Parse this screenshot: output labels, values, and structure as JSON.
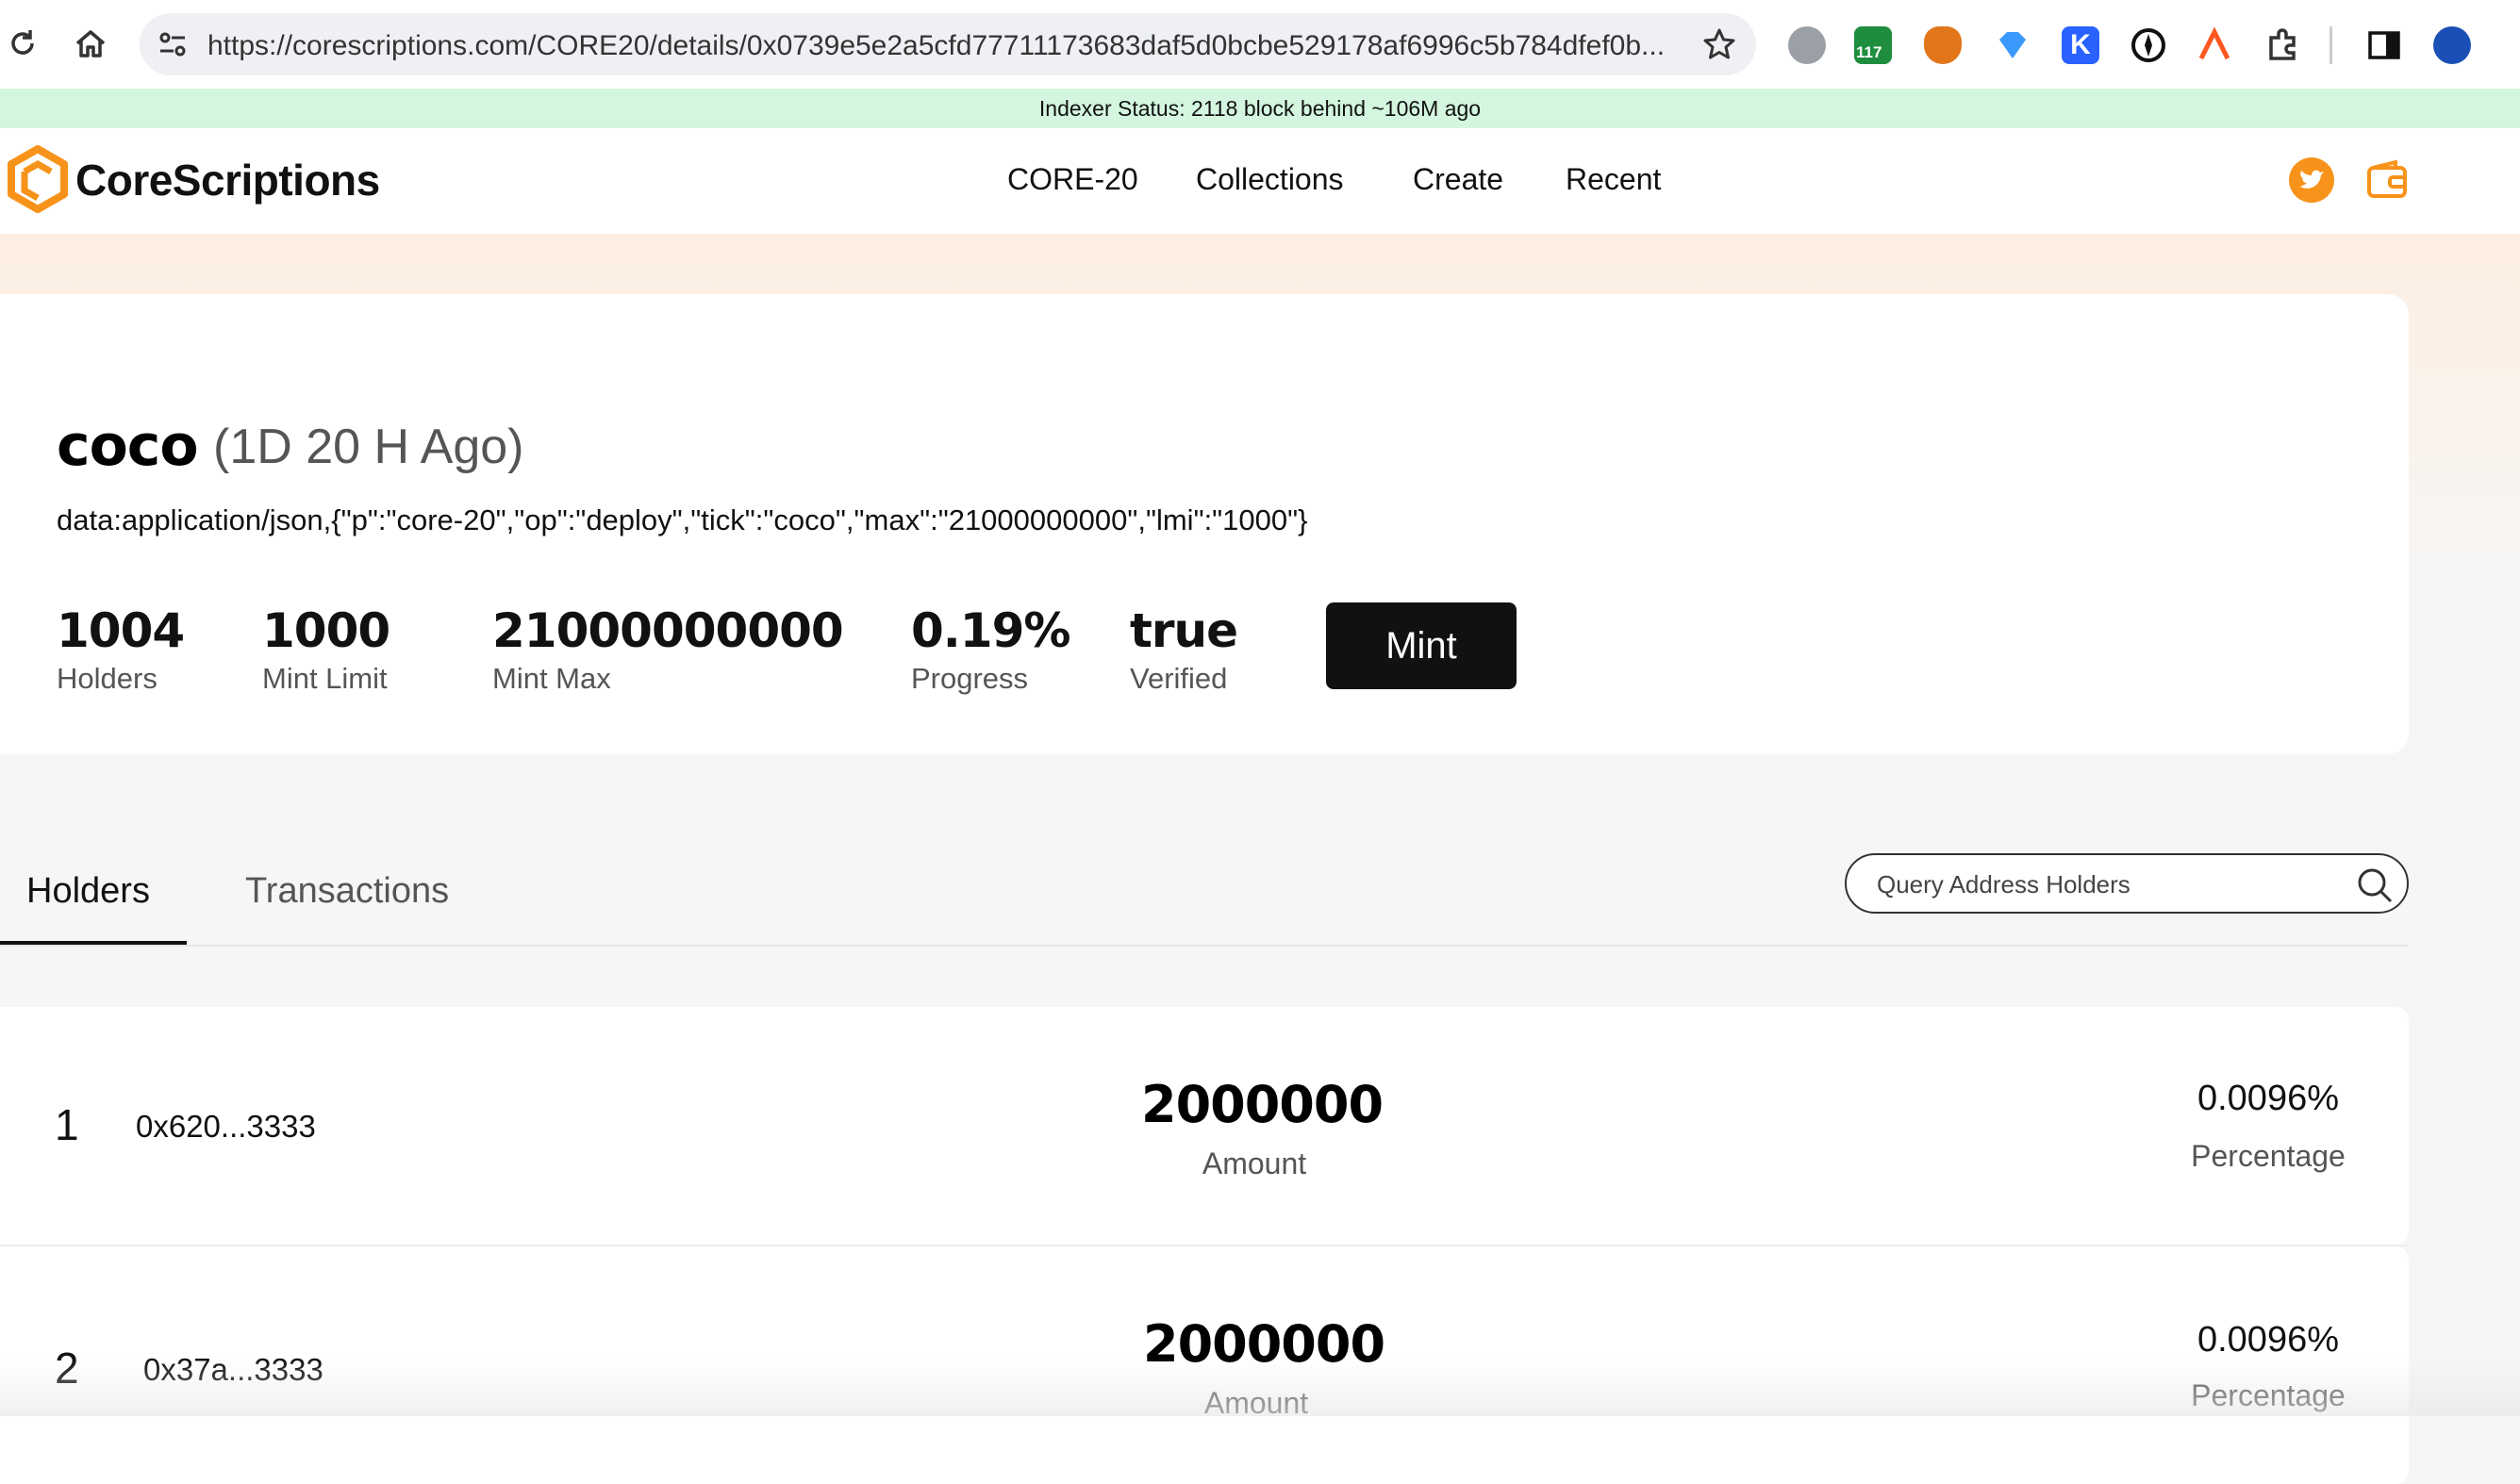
{
  "browser": {
    "url": "https://corescriptions.com/CORE20/details/0x0739e5e2a5cfd77711173683daf5d0bcbe529178af6996c5b784dfef0b...",
    "extension_badge": "117"
  },
  "indexer": {
    "status": "Indexer Status: 2118 block behind ~106M ago"
  },
  "header": {
    "logo_text": "CoreScriptions",
    "nav": [
      "CORE-20",
      "Collections",
      "Create",
      "Recent"
    ],
    "accent": "#f7931a"
  },
  "token": {
    "tick": "coco",
    "ago": "(1D 20 H Ago)",
    "data_string": "data:application/json,{\"p\":\"core-20\",\"op\":\"deploy\",\"tick\":\"coco\",\"max\":\"21000000000\",\"lmi\":\"1000\"}",
    "stats": [
      {
        "value": "1004",
        "label": "Holders"
      },
      {
        "value": "1000",
        "label": "Mint Limit"
      },
      {
        "value": "21000000000",
        "label": "Mint Max"
      },
      {
        "value": "0.19%",
        "label": "Progress"
      },
      {
        "value": "true",
        "label": "Verified"
      }
    ],
    "mint_label": "Mint"
  },
  "tabs": [
    {
      "label": "Holders",
      "active": true
    },
    {
      "label": "Transactions",
      "active": false
    }
  ],
  "search": {
    "placeholder": "Query Address Holders"
  },
  "holders": [
    {
      "rank": "1",
      "address": "0x620...3333",
      "amount": "2000000",
      "amount_label": "Amount",
      "percentage": "0.0096%",
      "percentage_label": "Percentage"
    },
    {
      "rank": "2",
      "address": "0x37a...3333",
      "amount": "2000000",
      "amount_label": "Amount",
      "percentage": "0.0096%",
      "percentage_label": "Percentage"
    }
  ]
}
